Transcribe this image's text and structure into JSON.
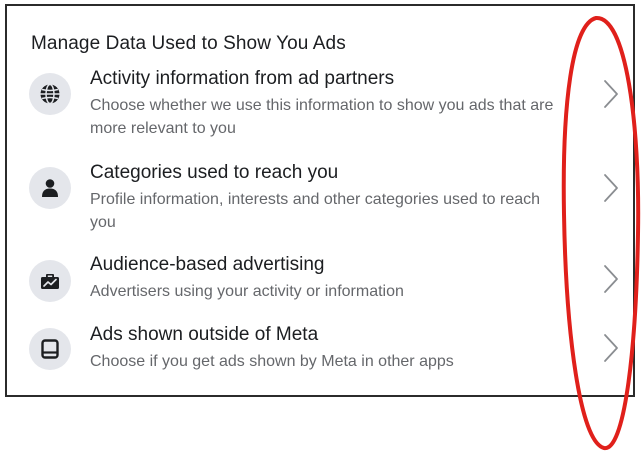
{
  "section": {
    "heading": "Manage Data Used to Show You Ads"
  },
  "items": [
    {
      "title": "Activity information from ad partners",
      "description": "Choose whether we use this information to show you ads that are more relevant to you",
      "icon": "globe-icon"
    },
    {
      "title": "Categories used to reach you",
      "description": "Profile information, interests and other categories used to reach you",
      "icon": "person-icon"
    },
    {
      "title": "Audience-based advertising",
      "description": "Advertisers using your activity or information",
      "icon": "briefcase-chart-icon"
    },
    {
      "title": "Ads shown outside of Meta",
      "description": "Choose if you get ads shown by Meta in other apps",
      "icon": "tablet-icon"
    }
  ],
  "colors": {
    "text_primary": "#1c1e21",
    "text_secondary": "#65676b",
    "icon_bg": "#e4e6eb",
    "annotation_red": "#e0201b"
  }
}
